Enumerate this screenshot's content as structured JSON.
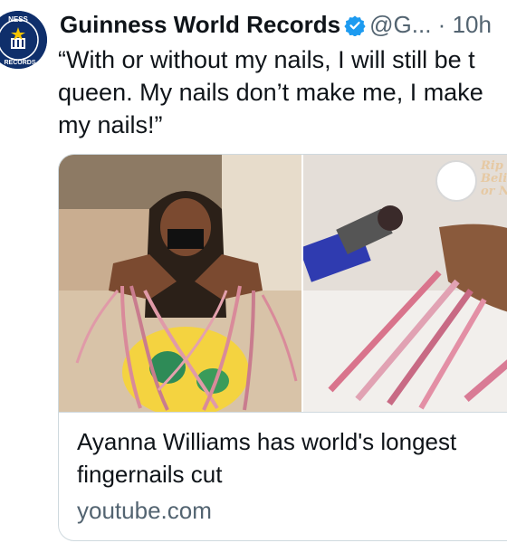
{
  "tweet": {
    "author_name": "Guinness World Records",
    "handle": "@G...",
    "separator": "·",
    "timestamp": "10h",
    "text": "“With or without my nails, I will still be t\nqueen. My nails don’t make me, I make\nmy nails!”"
  },
  "avatar": {
    "logo_top": "NESS",
    "logo_bottom": "RECORDS"
  },
  "card": {
    "title": "Ayanna Williams has world's longest\nfingernails cut",
    "domain": "youtube.com",
    "overlay_text": [
      "Rip",
      "Belie",
      "or N"
    ]
  },
  "icons": {
    "verified": "verified-badge-icon",
    "logo": "guinness-logo-icon"
  },
  "colors": {
    "verified": "#1d9bf0",
    "text": "#0f1419",
    "muted": "#536471",
    "border": "#cfd9de",
    "logo_navy": "#0f2f6b"
  }
}
